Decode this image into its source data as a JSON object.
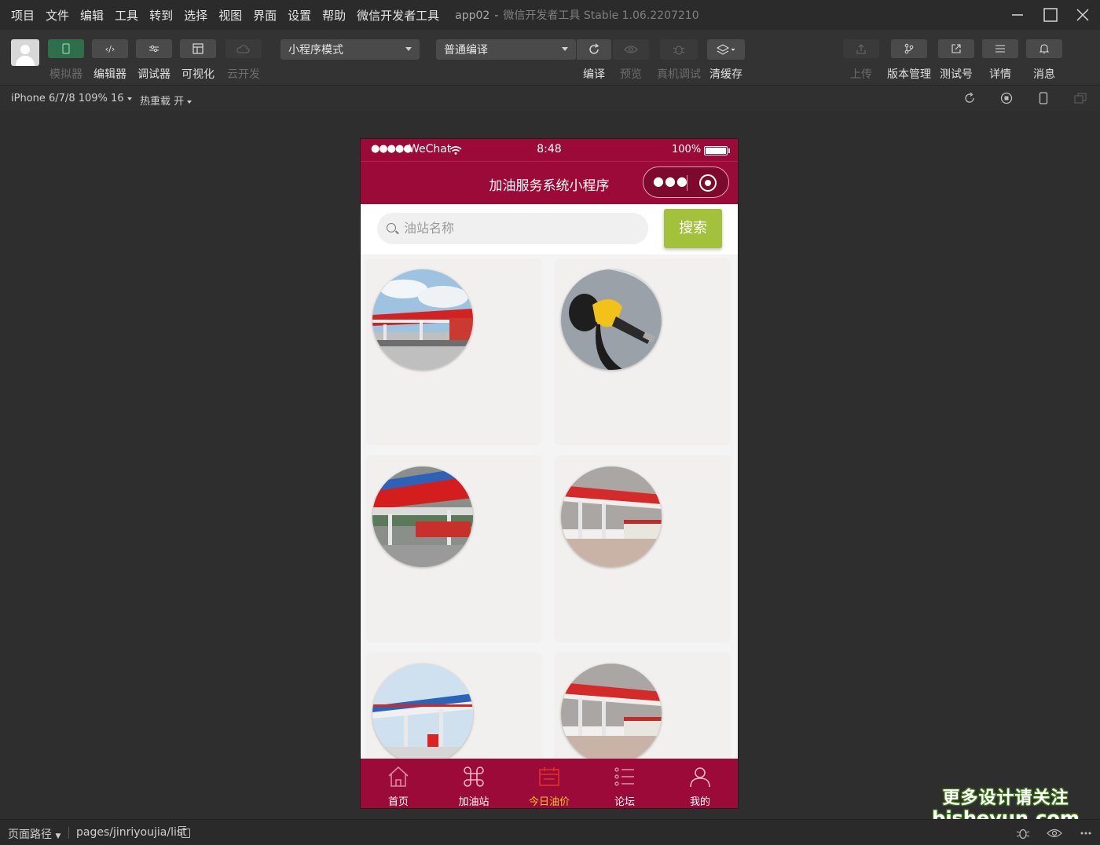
{
  "menu": [
    "项目",
    "文件",
    "编辑",
    "工具",
    "转到",
    "选择",
    "视图",
    "界面",
    "设置",
    "帮助",
    "微信开发者工具"
  ],
  "window": {
    "project": "app02",
    "separator": "-",
    "subtitle": "微信开发者工具 Stable 1.06.2207210"
  },
  "toolbar": {
    "simulator": "模拟器",
    "editor": "编辑器",
    "debugger": "调试器",
    "visualize": "可视化",
    "cloud": "云开发",
    "mode_select": "小程序模式",
    "compile_select": "普通编译",
    "compile": "编译",
    "preview": "预览",
    "remote_debug": "真机调试",
    "clear_cache": "清缓存",
    "upload": "上传",
    "version": "版本管理",
    "test_account": "测试号",
    "details": "详情",
    "messages": "消息"
  },
  "subbar": {
    "device": "iPhone 6/7/8 109% 16",
    "hot_reload": "热重载 开"
  },
  "phone": {
    "status": {
      "carrier": "WeChat",
      "time": "8:48",
      "battery": "100%"
    },
    "nav_title": "加油服务系统小程序",
    "search": {
      "placeholder": "油站名称",
      "button": "搜索"
    },
    "tabs": [
      {
        "label": "首页",
        "icon": "home-icon"
      },
      {
        "label": "加油站",
        "icon": "command-icon"
      },
      {
        "label": "今日油价",
        "icon": "calendar-icon"
      },
      {
        "label": "论坛",
        "icon": "list-icon"
      },
      {
        "label": "我的",
        "icon": "user-icon"
      }
    ],
    "active_tab": "今日油价",
    "colors": {
      "theme": "#9b0a38",
      "search_button": "#a3c13b",
      "active_tab": "#f5c226"
    }
  },
  "bottom": {
    "path_label": "页面路径",
    "path": "pages/jinriyoujia/list"
  },
  "watermark": {
    "line1": "更多设计请关注",
    "line2": "bisheyun.com"
  }
}
